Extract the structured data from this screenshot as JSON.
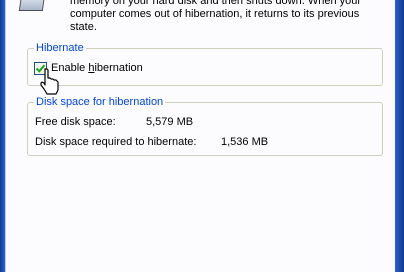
{
  "description": "memory on your hard disk and then shuts down. When your\ncomputer comes out of hibernation, it returns to its previous state.",
  "hibernate_group": {
    "legend": "Hibernate",
    "enable_checkbox": {
      "label": "Enable hibernation",
      "checked": true
    }
  },
  "disk_group": {
    "legend": "Disk space for hibernation",
    "rows": [
      {
        "label": "Free disk space:",
        "value": "5,579 MB"
      },
      {
        "label": "Disk space required to hibernate:",
        "value": "1,536 MB"
      }
    ]
  },
  "colors": {
    "legend_blue": "#0046d5",
    "checkmark_green": "#21a121",
    "frame_blue": "#2d62c6"
  }
}
